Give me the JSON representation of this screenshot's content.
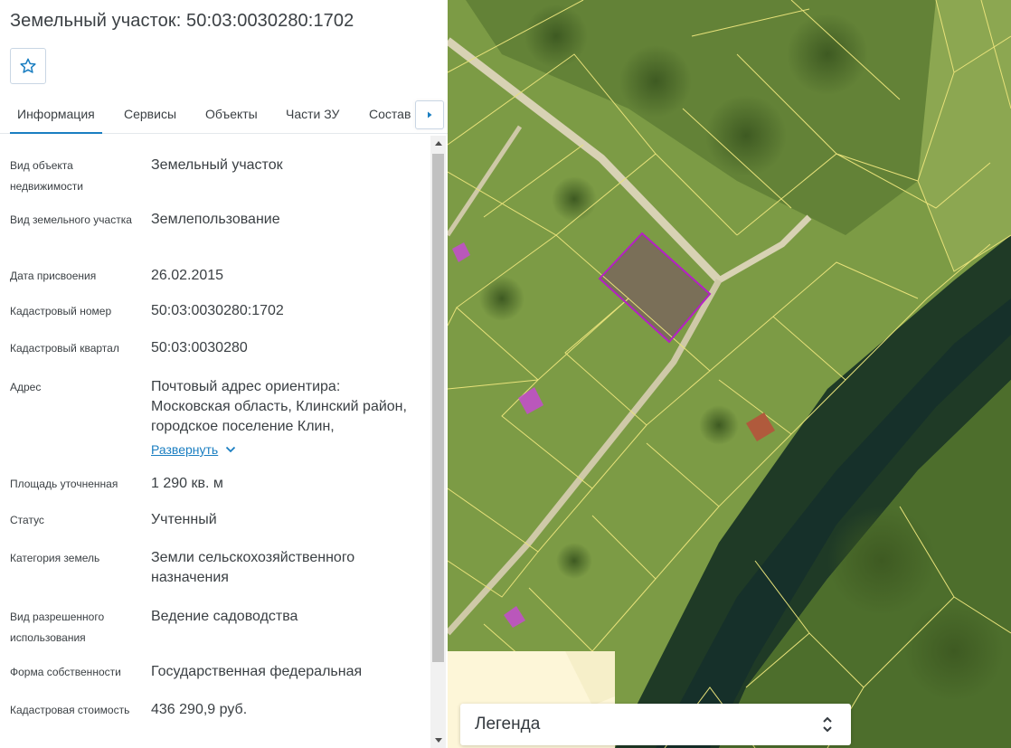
{
  "header": {
    "title": "Земельный участок: 50:03:0030280:1702"
  },
  "tabs": [
    {
      "label": "Информация",
      "active": true
    },
    {
      "label": "Сервисы",
      "active": false
    },
    {
      "label": "Объекты",
      "active": false
    },
    {
      "label": "Части ЗУ",
      "active": false
    },
    {
      "label": "Состав",
      "active": false
    }
  ],
  "info": {
    "object_type": {
      "label": "Вид объекта недвижимости",
      "value": "Земельный участок"
    },
    "plot_type": {
      "label": "Вид земельного участка",
      "value": "Землепользование"
    },
    "assign_date": {
      "label": "Дата присвоения",
      "value": "26.02.2015"
    },
    "cadastral_number": {
      "label": "Кадастровый номер",
      "value": "50:03:0030280:1702"
    },
    "cadastral_quarter": {
      "label": "Кадастровый квартал",
      "value": "50:03:0030280"
    },
    "address": {
      "label": "Адрес",
      "value": "Почтовый адрес ориентира: Московская область, Клинский район, городское поселение Клин,",
      "expand_label": "Развернуть"
    },
    "area": {
      "label": "Площадь уточненная",
      "value": "1 290 кв. м"
    },
    "status": {
      "label": "Статус",
      "value": "Учтенный"
    },
    "land_category": {
      "label": "Категория земель",
      "value": "Земли сельскохозяйственного назначения"
    },
    "permitted_use": {
      "label": "Вид разрешенного использования",
      "value": "Ведение садоводства"
    },
    "ownership": {
      "label": "Форма собственности",
      "value": "Государственная федеральная"
    },
    "cadastral_value": {
      "label": "Кадастровая стоимость",
      "value": "436 290,9 руб."
    }
  },
  "map": {
    "legend_label": "Легенда",
    "parcel_outline_color": "#b51fc6",
    "boundary_color": "#e8e27a",
    "building_color": "#c54bd0"
  },
  "icons": {
    "favorite": "star-icon",
    "tab_scroll": "chevron-right-icon",
    "expand": "chevron-down-icon",
    "legend_toggle": "chevron-up-down-icon"
  }
}
